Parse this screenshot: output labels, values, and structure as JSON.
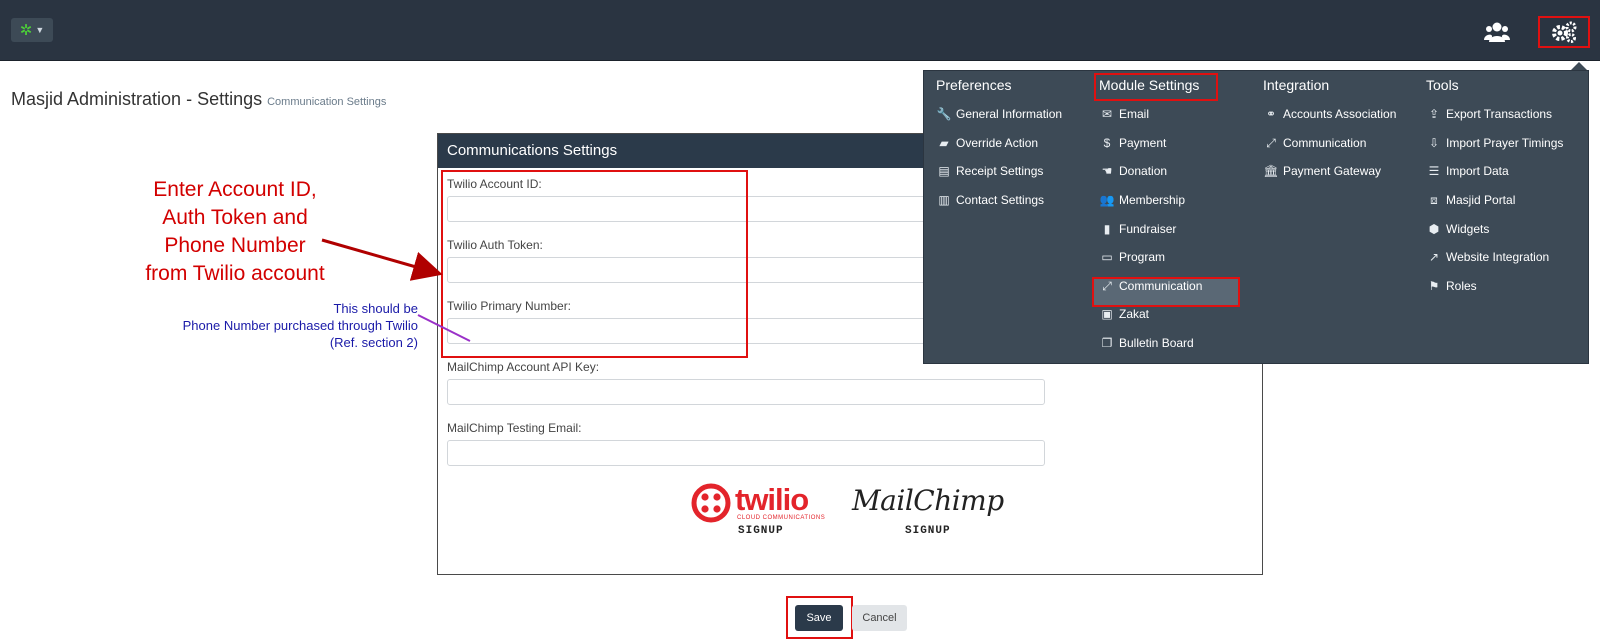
{
  "topbar": {
    "app_icon": "cog-green-icon",
    "users_icon": "users-icon",
    "settings_icon": "gears-icon"
  },
  "page": {
    "title": "Masjid Administration - Settings",
    "subtitle": "Communication Settings"
  },
  "panel": {
    "heading": "Communications Settings",
    "fields": [
      {
        "label": "Twilio Account ID:",
        "value": ""
      },
      {
        "label": "Twilio Auth Token:",
        "value": ""
      },
      {
        "label": "Twilio Primary Number:",
        "value": ""
      },
      {
        "label": "MailChimp Account API Key:",
        "value": ""
      },
      {
        "label": "MailChimp Testing Email:",
        "value": ""
      }
    ],
    "twilio_logo": "twilio",
    "twilio_tagline": "CLOUD COMMUNICATIONS",
    "twilio_signup": "SIGNUP",
    "mailchimp_logo": "MailChimp",
    "mailchimp_signup": "SIGNUP"
  },
  "buttons": {
    "save": "Save",
    "cancel": "Cancel"
  },
  "annotation": {
    "main": [
      "Enter Account ID,",
      "Auth Token and",
      "Phone Number",
      "from Twilio account"
    ],
    "sub": [
      "This should be",
      "Phone Number purchased through Twilio",
      "(Ref. section 2)"
    ],
    "colors": {
      "main": "#d20000",
      "sub": "#1a1aa8",
      "highlight": "#e01010"
    }
  },
  "menu": {
    "columns": [
      {
        "heading": "Preferences",
        "items": [
          {
            "label": "General Information",
            "icon": "wrench-icon"
          },
          {
            "label": "Override Action",
            "icon": "eraser-icon"
          },
          {
            "label": "Receipt Settings",
            "icon": "file-icon"
          },
          {
            "label": "Contact Settings",
            "icon": "building-icon"
          }
        ]
      },
      {
        "heading": "Module Settings",
        "items": [
          {
            "label": "Email",
            "icon": "envelope-icon"
          },
          {
            "label": "Payment",
            "icon": "dollar-icon"
          },
          {
            "label": "Donation",
            "icon": "hand-icon"
          },
          {
            "label": "Membership",
            "icon": "users-icon"
          },
          {
            "label": "Fundraiser",
            "icon": "bar-chart-icon"
          },
          {
            "label": "Program",
            "icon": "desktop-icon"
          },
          {
            "label": "Communication",
            "icon": "expand-icon"
          },
          {
            "label": "Zakat",
            "icon": "money-icon"
          },
          {
            "label": "Bulletin Board",
            "icon": "clone-icon"
          }
        ]
      },
      {
        "heading": "Integration",
        "items": [
          {
            "label": "Accounts Association",
            "icon": "link-icon"
          },
          {
            "label": "Communication",
            "icon": "expand-icon"
          },
          {
            "label": "Payment Gateway",
            "icon": "bank-icon"
          }
        ]
      },
      {
        "heading": "Tools",
        "items": [
          {
            "label": "Export Transactions",
            "icon": "upload-icon"
          },
          {
            "label": "Import Prayer Timings",
            "icon": "download-icon"
          },
          {
            "label": "Import Data",
            "icon": "database-icon"
          },
          {
            "label": "Masjid Portal",
            "icon": "cubes-icon"
          },
          {
            "label": "Widgets",
            "icon": "cube-icon"
          },
          {
            "label": "Website Integration",
            "icon": "external-link-icon"
          },
          {
            "label": "Roles",
            "icon": "flag-icon"
          }
        ]
      }
    ]
  }
}
